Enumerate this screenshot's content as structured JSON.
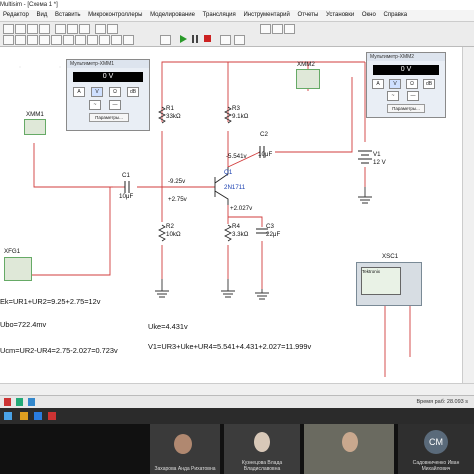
{
  "app": {
    "title": "Multisim - [Схема 1 *]"
  },
  "menu": [
    "Редактор",
    "Вид",
    "Вставить",
    "Микроконтроллеры",
    "Моделирование",
    "Трансляция",
    "Инструментарий",
    "Отчеты",
    "Установки",
    "Окно",
    "Справка"
  ],
  "multimeter1": {
    "title": "Мультиметр-XMM1",
    "display": "0 V",
    "buttons": [
      "A",
      "V",
      "Ω",
      "dB"
    ],
    "settings": "Параметры..."
  },
  "multimeter2": {
    "title": "Мультиметр-XMM2",
    "display": "0 V",
    "buttons": [
      "A",
      "V",
      "Ω",
      "dB"
    ],
    "settings": "Параметры..."
  },
  "instruments": {
    "xmm1": "XMM1",
    "xmm2": "XMM2",
    "xfg1": "XFG1",
    "xsc1": "XSC1",
    "scope_brand": "Tektronix"
  },
  "components": {
    "r1": {
      "name": "R1",
      "value": "33kΩ"
    },
    "r2": {
      "name": "R2",
      "value": "10kΩ"
    },
    "r3": {
      "name": "R3",
      "value": "9.1kΩ"
    },
    "r4": {
      "name": "R4",
      "value": "3.3kΩ"
    },
    "c1": {
      "name": "C1",
      "value": "10μF"
    },
    "c2": {
      "name": "C2",
      "value": "10μF"
    },
    "c3": {
      "name": "C3",
      "value": "22μF"
    },
    "q1": {
      "name": "Q1",
      "value": "2N1711"
    },
    "v1": {
      "name": "V1",
      "value": "12 V"
    }
  },
  "probes": {
    "p1": "-9.25v",
    "p2": "+2.75v",
    "p3": "-5.541v",
    "p4": "+2.027v"
  },
  "notes": {
    "n1": "Ek=UR1+UR2=9.25+2.75=12v",
    "n2": "Ubo=722.4mv",
    "n3": "Ucm=UR2-UR4=2.75-2.027=0.723v",
    "n4": "Uke=4.431v",
    "n5": "V1=UR3+Uke+UR4=5.541+4.431+2.027=11.999v"
  },
  "status": {
    "sim_time": "Время раб: 28.093 s"
  },
  "participants": [
    {
      "name": "Захарова Анда Рихатовна",
      "initials": ""
    },
    {
      "name": "Кузнецова Влада Владиславовна",
      "initials": ""
    },
    {
      "name": "",
      "initials": ""
    },
    {
      "name": "Садовниченко Иван Михайлович",
      "initials": "CM"
    }
  ],
  "colors": {
    "wire": "#d23c3c",
    "probe": "#1a3fb0"
  }
}
